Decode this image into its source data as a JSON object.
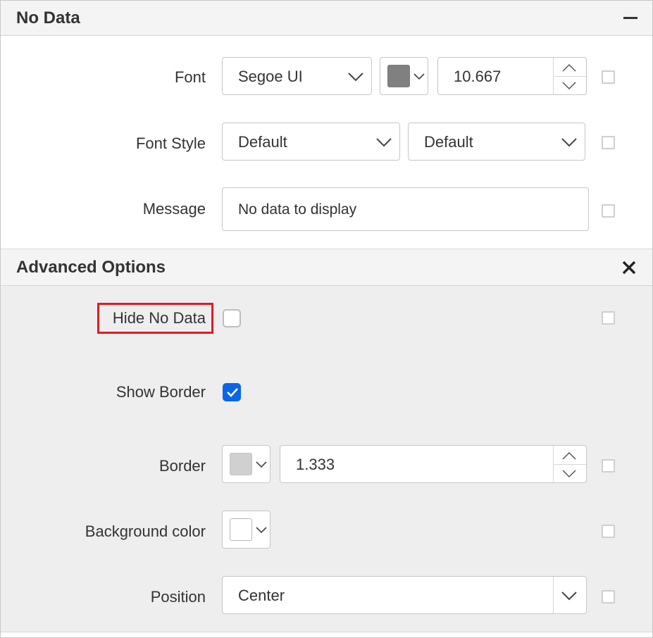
{
  "no_data_section": {
    "title": "No Data",
    "collapse_icon": "minus-icon",
    "font": {
      "label": "Font",
      "family_value": "Segoe UI",
      "color": "#808080",
      "size_value": "10.667"
    },
    "font_style": {
      "label": "Font Style",
      "style_value": "Default",
      "weight_value": "Default"
    },
    "message": {
      "label": "Message",
      "value": "No data to display"
    }
  },
  "advanced_section": {
    "title": "Advanced Options",
    "close_icon": "close-icon",
    "hide_no_data": {
      "label": "Hide No Data",
      "checked": false
    },
    "show_border": {
      "label": "Show Border",
      "checked": true
    },
    "border": {
      "label": "Border",
      "color": "#d0d0d0",
      "width_value": "1.333"
    },
    "background_color": {
      "label": "Background color",
      "color": "#ffffff"
    },
    "position": {
      "label": "Position",
      "value": "Center"
    }
  },
  "colors": {
    "accent": "#0a66e8",
    "highlight": "#e01b24"
  }
}
